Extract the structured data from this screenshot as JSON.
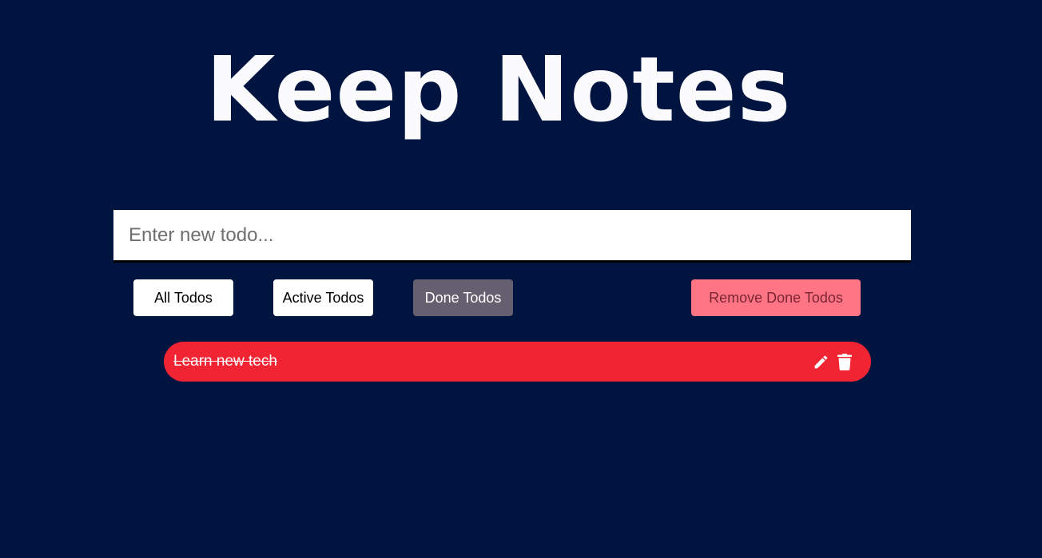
{
  "app": {
    "title": "Keep Notes"
  },
  "input": {
    "placeholder": "Enter new todo...",
    "value": ""
  },
  "filters": {
    "all_label": "All Todos",
    "active_label": "Active Todos",
    "done_label": "Done Todos",
    "selected": "Done Todos",
    "remove_done_label": "Remove Done Todos"
  },
  "todos": [
    {
      "text": "Learn new tech",
      "done": true,
      "actions": [
        "pencil-icon",
        "trash-icon"
      ]
    }
  ],
  "colors": {
    "background": "#001440",
    "title": "#fbfbfd",
    "selected_filter": "#655f70",
    "remove_button": "#ff7586",
    "todo_item": "#f02432"
  }
}
